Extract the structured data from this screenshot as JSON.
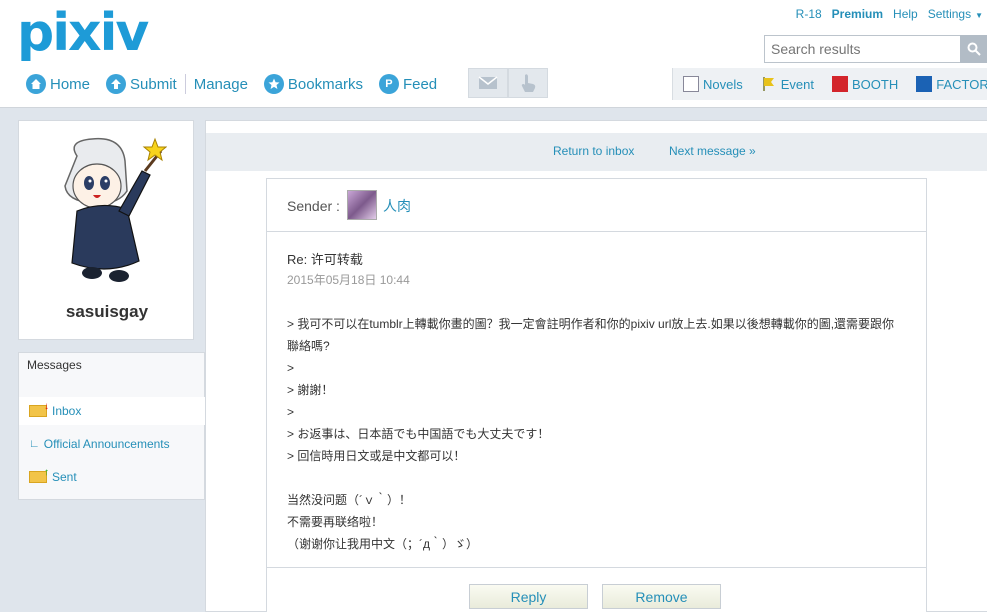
{
  "header": {
    "logo": "pixiv",
    "toplinks": [
      "R-18",
      "Premium",
      "Help",
      "Settings"
    ],
    "search": {
      "placeholder": "Search results"
    }
  },
  "nav": {
    "home": "Home",
    "submit": "Submit",
    "manage": "Manage",
    "bookmarks": "Bookmarks",
    "feed": "Feed"
  },
  "services": {
    "novels": "Novels",
    "event": "Event",
    "booth": "BOOTH",
    "factory": "FACTORY"
  },
  "profile": {
    "username": "sasuisgay"
  },
  "messages_panel": {
    "title": "Messages",
    "inbox": "Inbox",
    "announcements": "Official Announcements",
    "sent": "Sent"
  },
  "message_nav": {
    "return": "Return to inbox",
    "next": "Next message »"
  },
  "message": {
    "sender_label": "Sender :",
    "sender_name": "人肉",
    "subject": "Re: 许可转载",
    "date": "2015年05月18日 10:44",
    "body": "> 我可不可以在tumblr上轉載你畫的圖？我一定會註明作者和你的pixiv url放上去.如果以後想轉載你的圖,還需要跟你\n聯絡嗎?\n>\n> 謝謝！\n>\n> お返事は、日本語でも中国語でも大丈夫です！\n> 回信時用日文或是中文都可以！\n\n当然没问题（´ｖ｀）！\n不需要再联络啦！\n（谢谢你让我用中文（；´д｀）ゞ）"
  },
  "actions": {
    "reply": "Reply",
    "remove": "Remove"
  },
  "colors": {
    "brand": "#1e9bd7",
    "link": "#258fb8",
    "background": "#dfe5ec"
  }
}
